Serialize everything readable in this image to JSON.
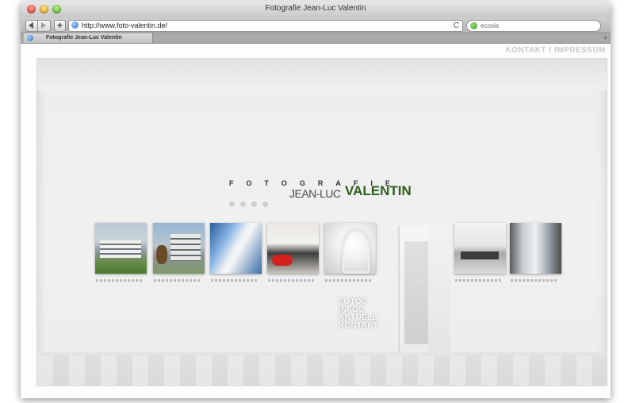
{
  "window": {
    "title": "Fotografie Jean-Luc Valentin"
  },
  "toolbar": {
    "url": "http://www.foto-valentin.de/",
    "search_placeholder": "ecosia",
    "reload_glyph": "C",
    "add_glyph": "+"
  },
  "tab": {
    "label": "Fotografie Jean-Luc Valentin",
    "new_tab_glyph": "+"
  },
  "page": {
    "top_nav": [
      "KONTAKT",
      "I",
      "IMPRESSUM"
    ],
    "logo": {
      "line1": "FOTOGRAFIE",
      "line2_left": "JEAN-LUC",
      "line2_right": "VALENTIN"
    },
    "menu": [
      "FOTOS",
      "INFOS",
      "AKTUELL",
      "KONTAKT"
    ],
    "colors": {
      "logo_green": "#2b5f1b",
      "nav_grey": "#c9c9c9"
    }
  }
}
